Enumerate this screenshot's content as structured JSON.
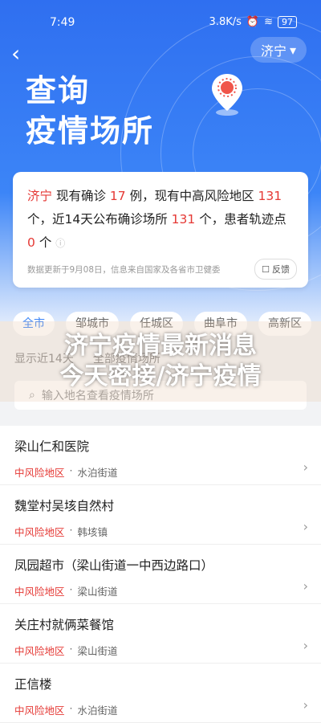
{
  "status": {
    "time": "7:49",
    "speed": "3.8K/s",
    "battery": "97"
  },
  "header": {
    "city": "济宁",
    "title_line1": "查询",
    "title_line2": "疫情场所"
  },
  "summary": {
    "city": "济宁",
    "t1": "现有确诊",
    "confirmed": "17",
    "t2": "例，现有中高风险地区",
    "risk_areas": "131",
    "t3": "个，近14天公布确诊场所",
    "places": "131",
    "t4": "个，患者轨迹点",
    "trajectories": "0",
    "t5": "个",
    "footnote": "数据更新于9月08日，信息来自国家及各省市卫健委",
    "feedback": "反馈"
  },
  "tabs": [
    "全市",
    "邹城市",
    "任城区",
    "曲阜市",
    "高新区"
  ],
  "filters": {
    "period": "显示近14天",
    "type": "全部疫情场所"
  },
  "search": {
    "placeholder": "输入地名查看疫情场所"
  },
  "overlay": {
    "line1": "济宁疫情最新消息",
    "line2": "今天密接/济宁疫情"
  },
  "places": [
    {
      "name": "梁山仁和医院",
      "risk": "中风险地区",
      "street": "水泊街道"
    },
    {
      "name": "魏堂村吴垓自然村",
      "risk": "中风险地区",
      "street": "韩垓镇"
    },
    {
      "name": "凤园超市（梁山街道一中西边路口）",
      "risk": "中风险地区",
      "street": "梁山街道"
    },
    {
      "name": "关庄村就俩菜餐馆",
      "risk": "中风险地区",
      "street": "梁山街道"
    },
    {
      "name": "正信楼",
      "risk": "中风险地区",
      "street": "水泊街道"
    }
  ],
  "colors": {
    "brand": "#3c85f7",
    "risk": "#e53935"
  }
}
